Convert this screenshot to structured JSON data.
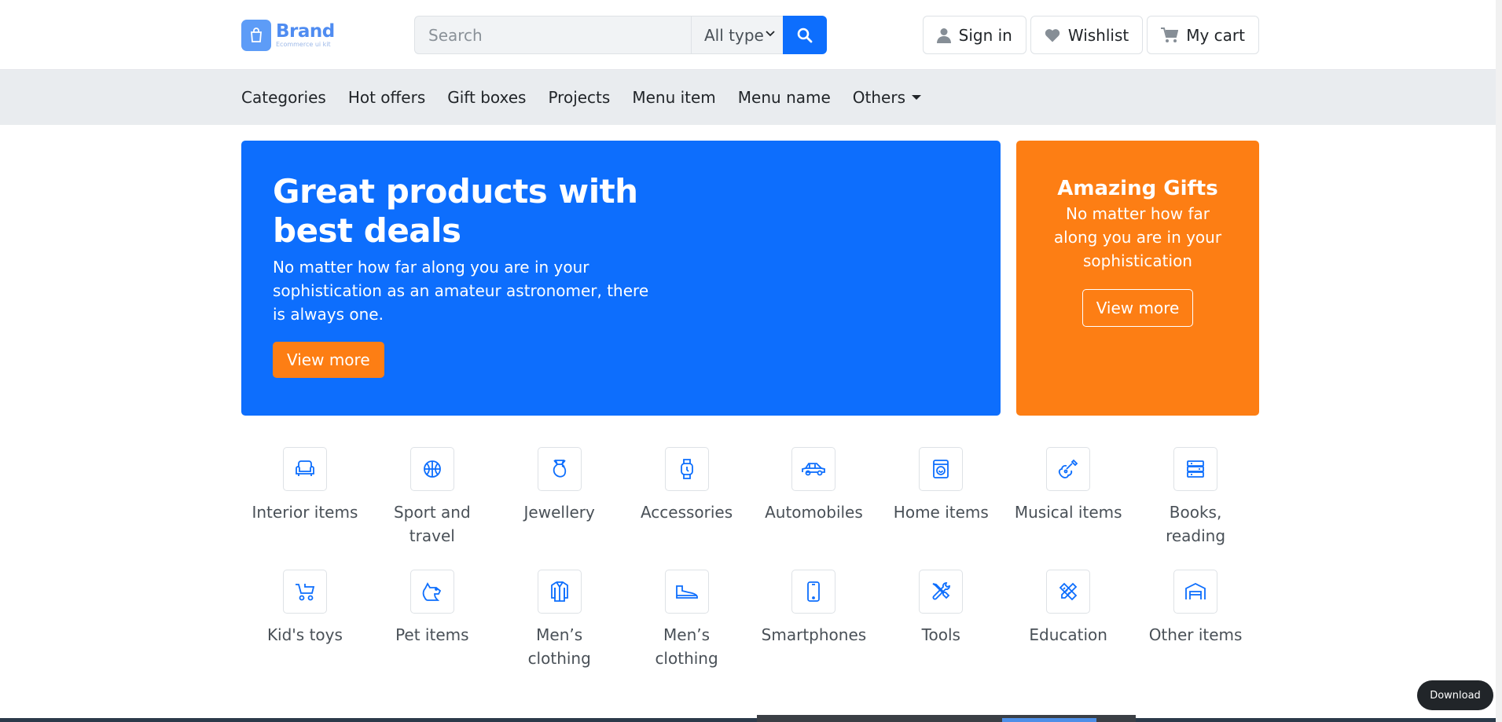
{
  "brand": {
    "name": "Brand",
    "tagline": "Ecommerce ui kit"
  },
  "search": {
    "placeholder": "Search",
    "type_value": "All type"
  },
  "actions": {
    "sign_in": "Sign in",
    "wishlist": "Wishlist",
    "cart": "My cart"
  },
  "nav": {
    "items": [
      "Categories",
      "Hot offers",
      "Gift boxes",
      "Projects",
      "Menu item",
      "Menu name",
      "Others"
    ]
  },
  "hero": {
    "title": "Great products with best deals",
    "text": "No matter how far along you are in your sophistication as an amateur astronomer, there is always one.",
    "button": "View more"
  },
  "gift": {
    "title": "Amazing Gifts",
    "text": "No matter how far along you are in your sophistication",
    "button": "View more"
  },
  "categories": [
    {
      "label": "Interior items",
      "icon": "couch-icon"
    },
    {
      "label": "Sport and travel",
      "icon": "basketball-icon"
    },
    {
      "label": "Jewellery",
      "icon": "ring-icon"
    },
    {
      "label": "Accessories",
      "icon": "watch-icon"
    },
    {
      "label": "Automobiles",
      "icon": "car-icon"
    },
    {
      "label": "Home items",
      "icon": "washing-machine-icon"
    },
    {
      "label": "Musical items",
      "icon": "guitar-icon"
    },
    {
      "label": "Books, reading",
      "icon": "books-icon"
    },
    {
      "label": "Kid's toys",
      "icon": "stroller-icon"
    },
    {
      "label": "Pet items",
      "icon": "dog-icon"
    },
    {
      "label": "Men’s clothing",
      "icon": "shirt-icon"
    },
    {
      "label": "Men’s clothing",
      "icon": "shoe-icon"
    },
    {
      "label": "Smartphones",
      "icon": "smartphone-icon"
    },
    {
      "label": "Tools",
      "icon": "tools-icon"
    },
    {
      "label": "Education",
      "icon": "pencil-ruler-icon"
    },
    {
      "label": "Other items",
      "icon": "warehouse-icon"
    }
  ],
  "download": "Download",
  "colors": {
    "primary": "#0d6efd",
    "accent": "#fd7e14",
    "nav_bg": "#e9ecef"
  }
}
